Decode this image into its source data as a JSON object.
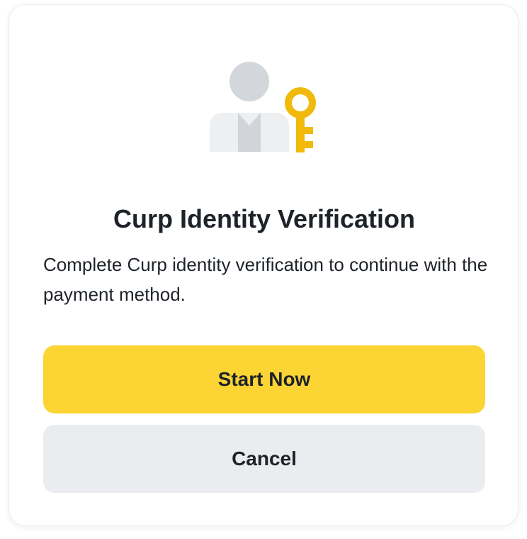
{
  "dialog": {
    "illustration": "user-with-key-icon",
    "title": "Curp Identity Verification",
    "description": "Complete Curp identity verification to continue with the payment method.",
    "primary_button_label": "Start Now",
    "secondary_button_label": "Cancel"
  },
  "colors": {
    "accent": "#FCD535",
    "key": "#F0B90B",
    "secondary_button": "#EAECEF",
    "text": "#1E2329",
    "avatar_head": "#D3D6DB",
    "avatar_body": "#EEEFF1",
    "avatar_tie": "#D1D4D9"
  }
}
